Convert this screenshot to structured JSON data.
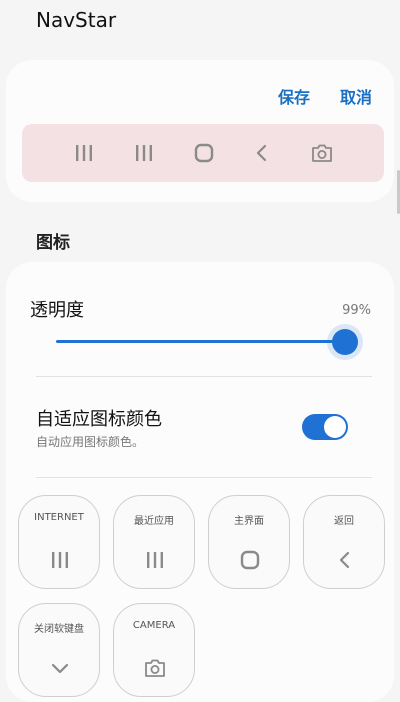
{
  "app": {
    "title": "NavStar"
  },
  "preview": {
    "save_label": "保存",
    "cancel_label": "取消",
    "nav_icons": [
      "recents-icon",
      "recents-icon",
      "home-icon",
      "back-icon",
      "camera-icon"
    ]
  },
  "section": {
    "icons_header": "图标"
  },
  "opacity": {
    "label": "透明度",
    "value_text": "99%",
    "value_fraction": 0.99
  },
  "adaptive": {
    "title": "自适应图标颜色",
    "subtitle": "自动应用图标颜色。",
    "enabled": true
  },
  "buttons": [
    {
      "label": "INTERNET",
      "icon": "recents-icon"
    },
    {
      "label": "最近应用",
      "icon": "recents-icon"
    },
    {
      "label": "主界面",
      "icon": "home-icon"
    },
    {
      "label": "返回",
      "icon": "back-icon"
    },
    {
      "label": "关闭软键盘",
      "icon": "chevron-down-icon"
    },
    {
      "label": "CAMERA",
      "icon": "camera-icon"
    }
  ],
  "colors": {
    "accent": "#1f72d3",
    "link": "#1a6fc2",
    "preview_bar": "#f4e1e3",
    "icon_gray": "#8a8a8a"
  }
}
